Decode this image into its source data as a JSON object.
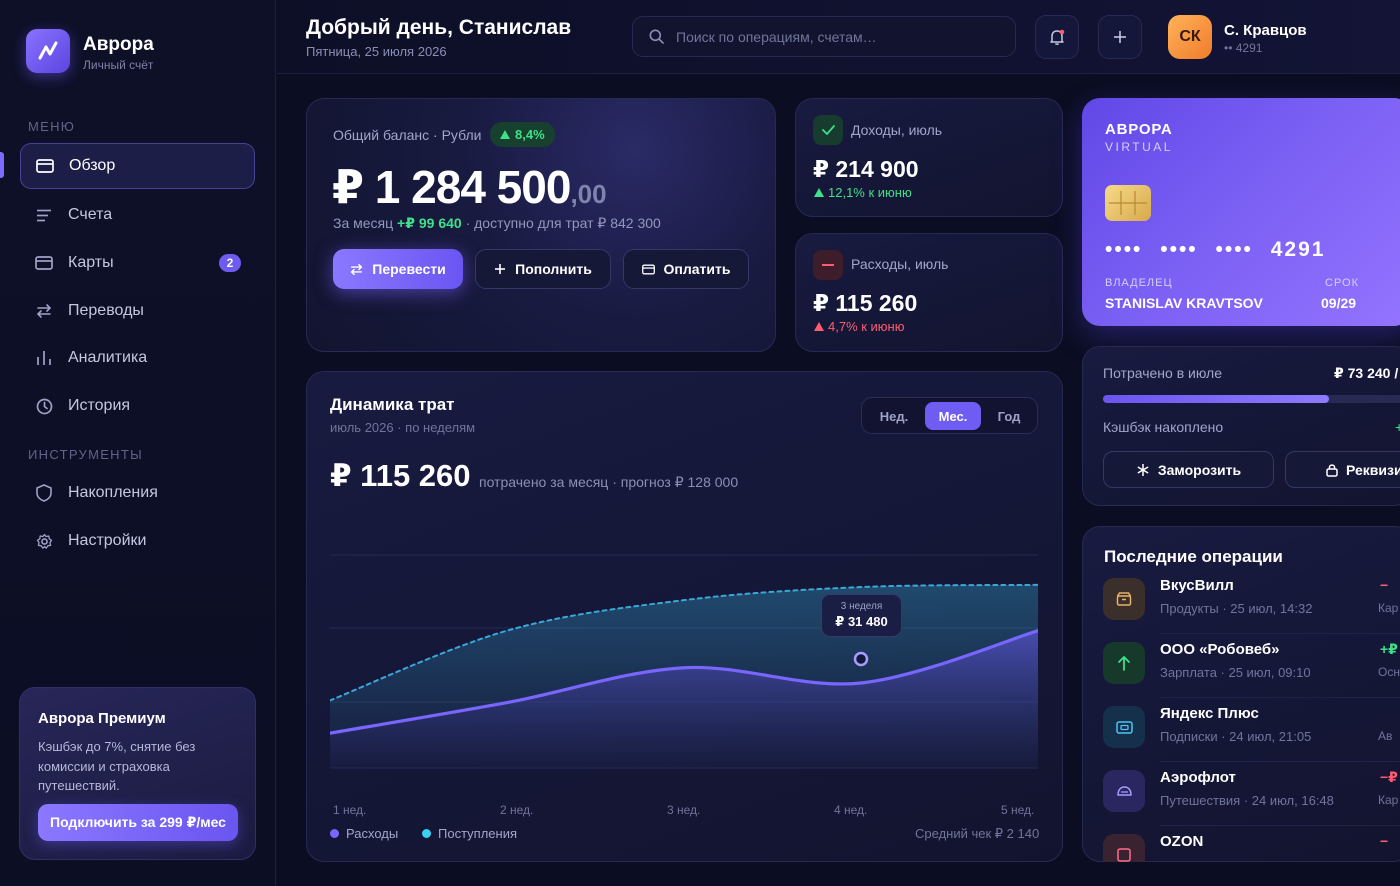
{
  "brand": {
    "name": "Аврора",
    "subtitle": "Личный счёт"
  },
  "sidebar": {
    "menu_label": "МЕНЮ",
    "tools_label": "ИНСТРУМЕНТЫ",
    "items": [
      {
        "label": "Обзор",
        "icon": "card-icon",
        "active": true
      },
      {
        "label": "Счета",
        "icon": "list-icon"
      },
      {
        "label": "Карты",
        "icon": "card-icon",
        "badge": "2"
      },
      {
        "label": "Переводы",
        "icon": "transfer-icon"
      },
      {
        "label": "Аналитика",
        "icon": "bar-chart-icon"
      },
      {
        "label": "История",
        "icon": "clock-icon"
      }
    ],
    "tools": [
      {
        "label": "Накопления",
        "icon": "shield-icon"
      },
      {
        "label": "Настройки",
        "icon": "gear-icon"
      }
    ],
    "premium": {
      "title": "Аврора Премиум",
      "text": "Кэшбэк до 7%, снятие без комиссии и страховка путешествий.",
      "button": "Подключить за 299 ₽/мес"
    }
  },
  "header": {
    "greeting": "Добрый день, Станислав",
    "date": "Пятница, 25 июля 2026",
    "search_placeholder": "Поиск по операциям, счетам…",
    "user": {
      "initials": "СК",
      "name": "С. Кравцов",
      "account": "•• 4291"
    }
  },
  "balance": {
    "label": "Общий баланс · Рубли",
    "change": "8,4%",
    "amount": "₽ 1 284 500",
    "cents": ",00",
    "month_prefix": "За месяц",
    "month_value": "+₽ 99 640",
    "available": "· доступно для трат ₽ 842 300",
    "actions": {
      "transfer": "Перевести",
      "topup": "Пополнить",
      "pay": "Оплатить"
    }
  },
  "income": {
    "label": "Доходы, июль",
    "value": "₽ 214 900",
    "delta": "12,1% к июню",
    "color": "#3ee08a"
  },
  "expenses": {
    "label": "Расходы, июль",
    "value": "₽ 115 260",
    "delta": "4,7% к июню",
    "color": "#ff5c72"
  },
  "bank_card": {
    "brand": "АВРОРА",
    "type": "VIRTUAL",
    "number": "•••• •••• •••• 4291",
    "holder_label": "ВЛАДЕЛЕЦ",
    "holder": "STANISLAV KRAVTSOV",
    "expiry_label": "СРОК",
    "expiry": "09/29"
  },
  "limits": {
    "spent_label": "Потрачено в июле",
    "spent_value": "₽ 73 240 /",
    "progress": 0.73,
    "cashback_label": "Кэшбэк накоплено",
    "cashback_mark": "+",
    "freeze": "Заморозить",
    "details": "Реквизи"
  },
  "chart": {
    "title": "Динамика трат",
    "subtitle": "июль 2026 · по неделям",
    "total": "₽ 115 260",
    "total_sub": "потрачено за месяц · прогноз ₽ 128 000",
    "tabs": [
      "Нед.",
      "Мес.",
      "Год"
    ],
    "active_tab": 1,
    "tooltip": {
      "label": "3 неделя",
      "value": "₽ 31 480"
    },
    "legend": [
      "Расходы",
      "Поступления"
    ],
    "avg_check": "Средний чек ₽ 2 140"
  },
  "chart_data": {
    "type": "area",
    "x": [
      "1 нед.",
      "2 нед.",
      "3 нед.",
      "4 нед.",
      "5 нед."
    ],
    "ylim": [
      0,
      1
    ],
    "grid": true,
    "series": [
      {
        "name": "Расходы",
        "color": "#7866ff",
        "values": [
          0.16,
          0.3,
          0.46,
          0.39,
          0.63
        ],
        "style": "solid"
      },
      {
        "name": "Поступления",
        "color": "#3aa7d8",
        "values": [
          0.31,
          0.63,
          0.77,
          0.83,
          0.84
        ],
        "style": "dashed"
      }
    ],
    "highlight": {
      "x": "4 нед.",
      "value": 0.5
    }
  },
  "transactions": {
    "title": "Последние операции",
    "items": [
      {
        "name": "ВкусВилл",
        "meta": "Продукты · 25 июл, 14:32",
        "amount": "−",
        "source": "Кар",
        "icon": "basket-icon",
        "bg": "#3a2f2a",
        "fg": "#e8b36a",
        "amount_color": "#ff5c72"
      },
      {
        "name": "ООО «Робовеб»",
        "meta": "Зарплата · 25 июл, 09:10",
        "amount": "+₽",
        "source": "Осно",
        "icon": "arrow-up-icon",
        "bg": "#16392b",
        "fg": "#3ee08a",
        "amount_color": "#3ee08a"
      },
      {
        "name": "Яндекс Плюс",
        "meta": "Подписки · 24 июл, 21:05",
        "amount": "",
        "source": "Ав",
        "icon": "ticket-icon",
        "bg": "#15304a",
        "fg": "#4fc3f7",
        "amount_color": "#ffffff"
      },
      {
        "name": "Аэрофлот",
        "meta": "Путешествия · 24 июл, 16:48",
        "amount": "−₽",
        "source": "Кар",
        "icon": "plane-icon",
        "bg": "#2a2760",
        "fg": "#a79bff",
        "amount_color": "#ff5c72"
      },
      {
        "name": "OZON",
        "meta": "",
        "amount": "−",
        "source": "",
        "icon": "box-icon",
        "bg": "#3a2330",
        "fg": "#ff6d8a",
        "amount_color": "#ff5c72"
      }
    ]
  }
}
